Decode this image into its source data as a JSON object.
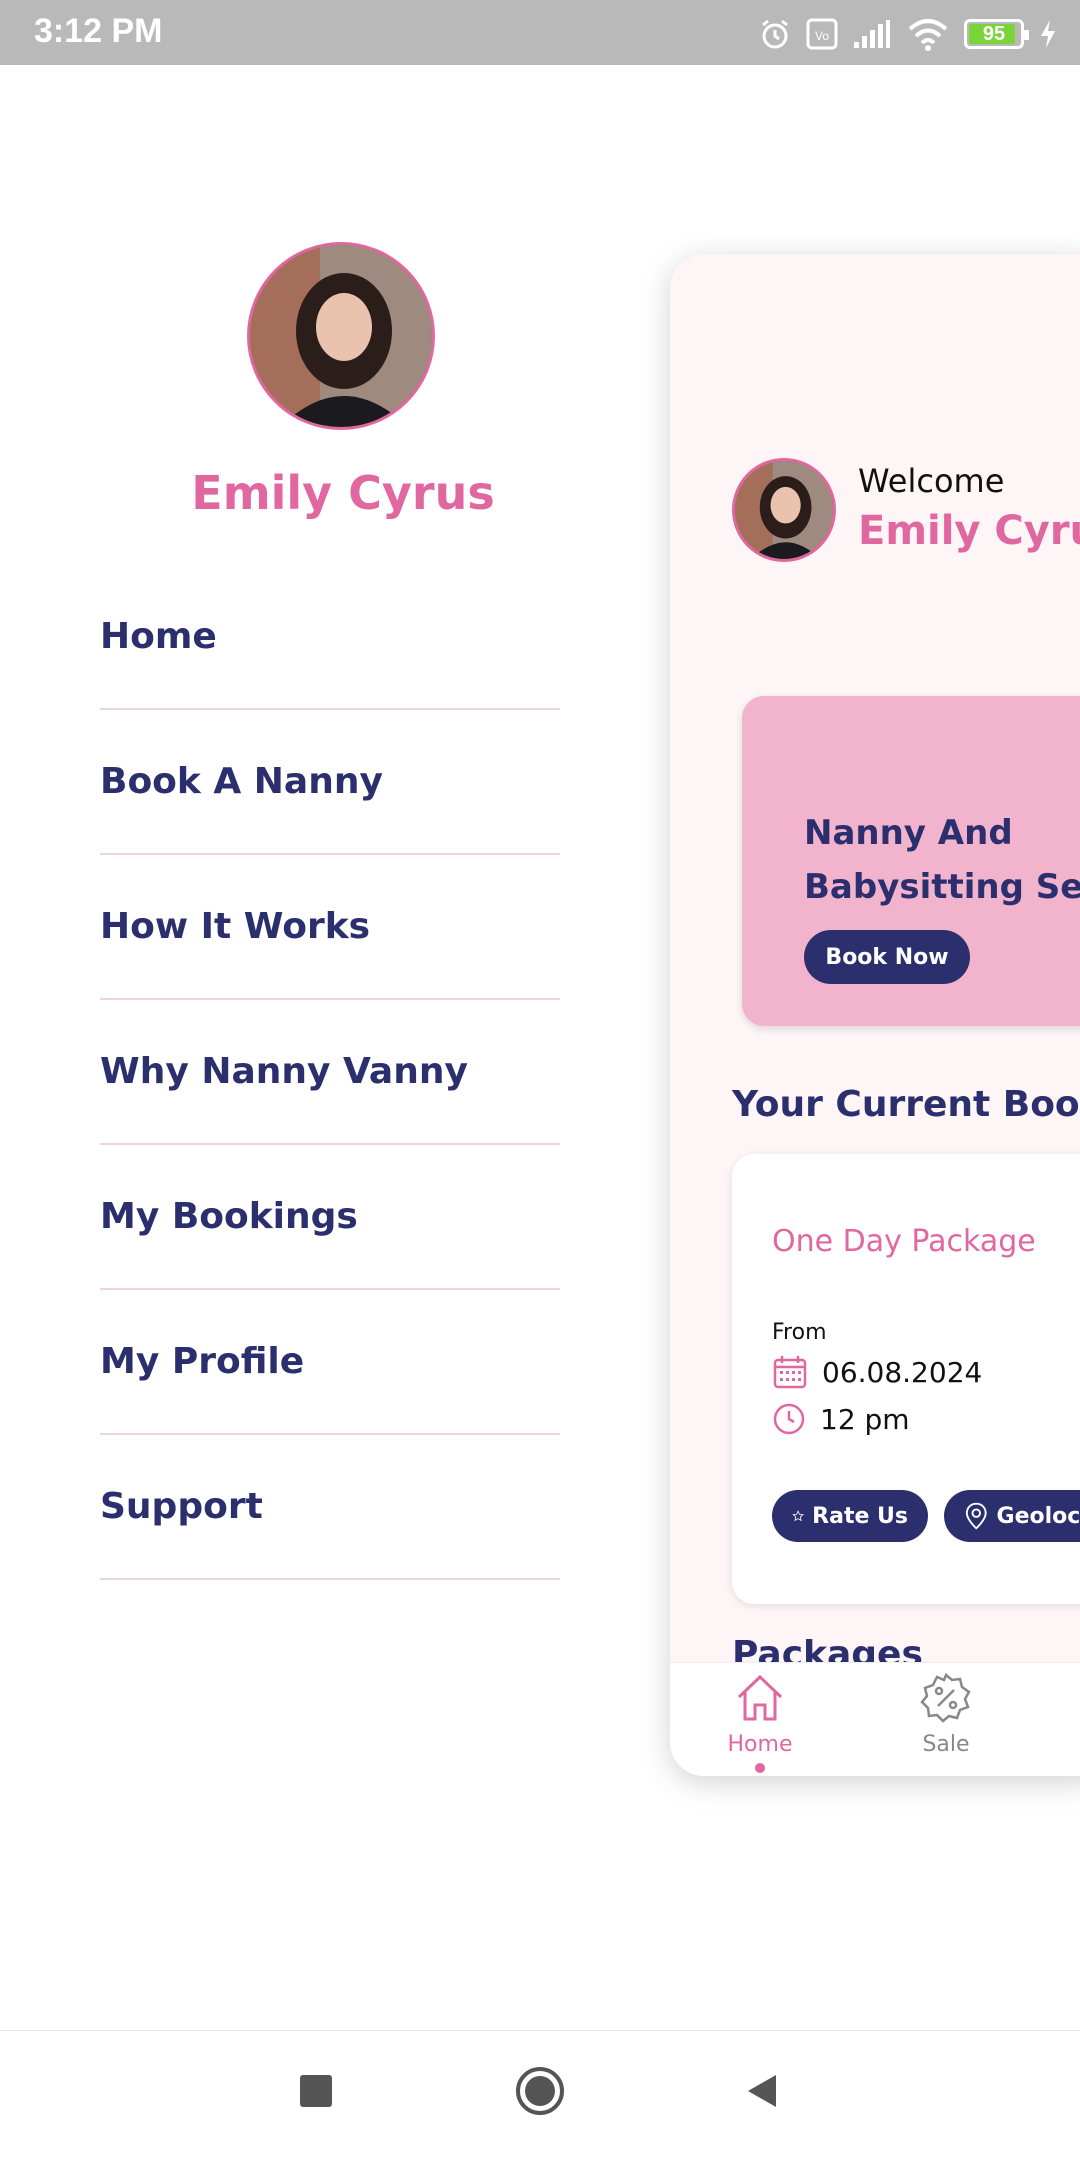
{
  "status_bar": {
    "time": "3:12 PM",
    "battery_level": "95",
    "icons": [
      "alarm-icon",
      "volte-icon",
      "signal-icon",
      "wifi-icon",
      "battery-icon",
      "charging-icon"
    ]
  },
  "drawer": {
    "user_name": "Emily Cyrus",
    "menu": [
      {
        "label": "Home"
      },
      {
        "label": "Book A Nanny"
      },
      {
        "label": "How It Works"
      },
      {
        "label": "Why Nanny Vanny"
      },
      {
        "label": "My Bookings"
      },
      {
        "label": "My Profile"
      },
      {
        "label": "Support"
      }
    ]
  },
  "main": {
    "welcome_label": "Welcome",
    "user_name": "Emily Cyrus",
    "banner": {
      "title_line1": "Nanny And",
      "title_line2": "Babysitting Service",
      "button_label": "Book Now"
    },
    "current_bookings_title": "Your Current Booking",
    "booking": {
      "package_name": "One Day Package",
      "from_label": "From",
      "date": "06.08.2024",
      "time": "12 pm",
      "rate_label": "Rate Us",
      "geo_label": "Geolocation"
    },
    "packages_title": "Packages",
    "bottom_nav": [
      {
        "label": "Home",
        "icon": "home-icon",
        "active": true
      },
      {
        "label": "Sale",
        "icon": "discount-icon",
        "active": false
      }
    ]
  },
  "colors": {
    "accent_pink": "#e0679f",
    "navy": "#2b2f6e",
    "banner_pink": "#f2b3cd"
  }
}
